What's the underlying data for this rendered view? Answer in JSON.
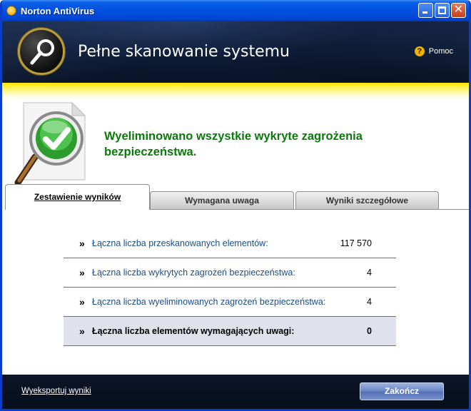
{
  "window": {
    "title": "Norton AntiVirus",
    "controls": {
      "minimize": "minimize",
      "maximize": "maximize",
      "close": "close"
    }
  },
  "header": {
    "title": "Pełne skanowanie systemu",
    "help_label": "Pomoc",
    "help_icon": "?"
  },
  "status": {
    "icon": "magnifier-checkmark-icon",
    "message": "Wyeliminowano wszystkie wykryte zagrożenia bezpieczeństwa."
  },
  "tabs": [
    {
      "label": "Zestawienie wyników",
      "active": true
    },
    {
      "label": "Wymagana uwaga",
      "active": false
    },
    {
      "label": "Wyniki szczegółowe",
      "active": false
    }
  ],
  "results": [
    {
      "label": "Łączna liczba przeskanowanych elementów:",
      "value": "117 570"
    },
    {
      "label": "Łączna liczba wykrytych zagrożeń bezpieczeństwa:",
      "value": "4"
    },
    {
      "label": "Łączna liczba wyeliminowanych zagrożeń bezpieczeństwa:",
      "value": "4"
    },
    {
      "label": "Łączna liczba elementów wymagających uwagi:",
      "value": "0"
    }
  ],
  "footer": {
    "export_label": "Wyeksportuj wyniki",
    "finish_label": "Zakończ"
  },
  "colors": {
    "titlebar": "#0050e0",
    "status_green": "#0a7a0a",
    "link_blue": "#1a4d8a",
    "highlight_row": "#dfe1ec",
    "accent_yellow": "#ffe600"
  }
}
